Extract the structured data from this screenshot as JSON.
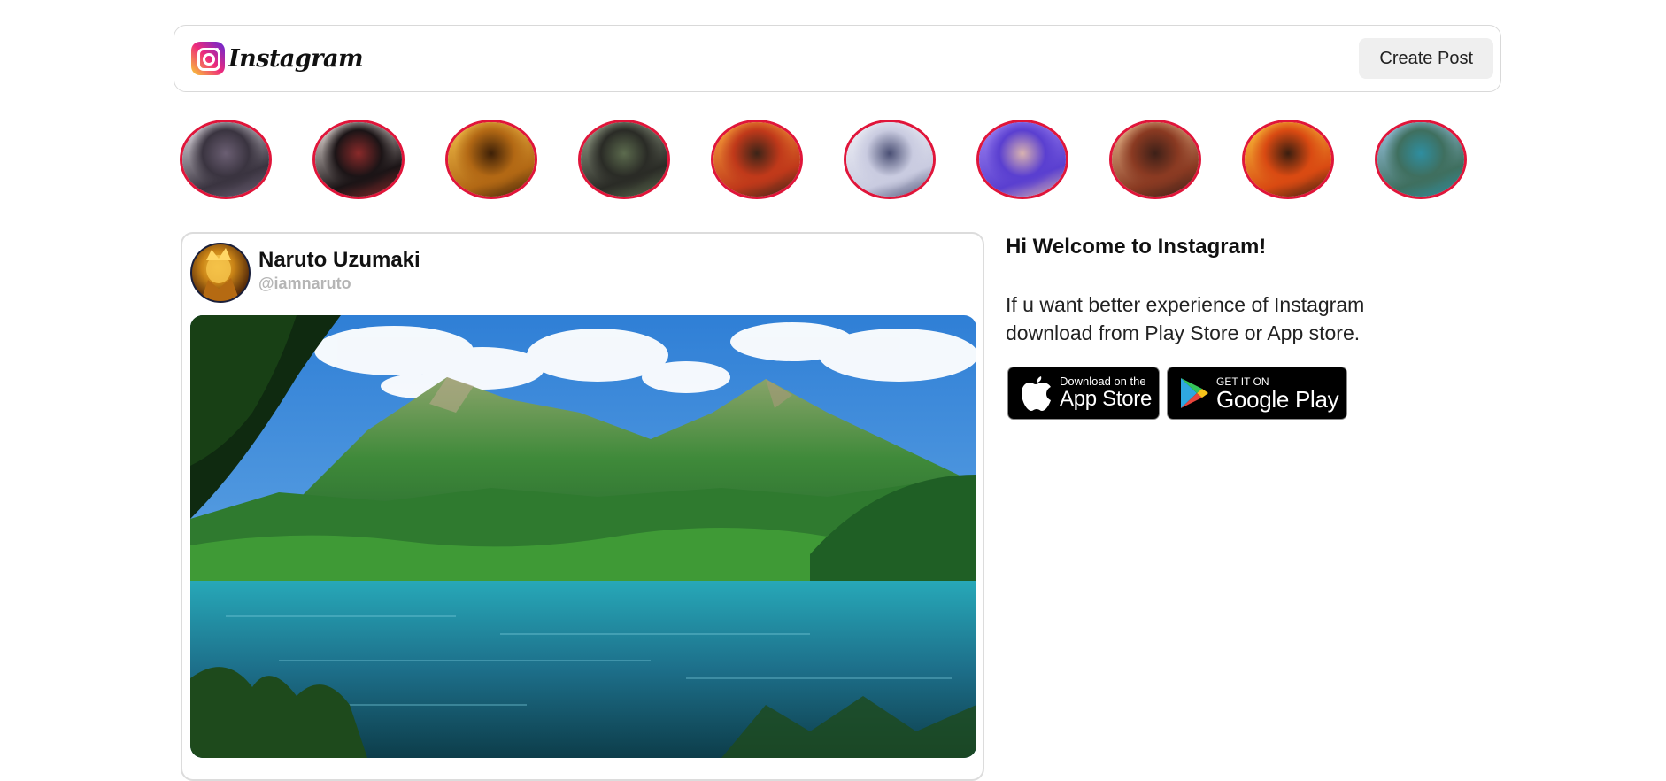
{
  "header": {
    "brand_name": "Instagram",
    "create_button_label": "Create Post"
  },
  "stories": [
    {
      "name": "story-sasuke",
      "colors": [
        "#e8e3ea",
        "#3a3440",
        "#6b5f73"
      ]
    },
    {
      "name": "story-itachi",
      "colors": [
        "#f2e9e4",
        "#1b1416",
        "#8a2a2a"
      ]
    },
    {
      "name": "story-naruto",
      "colors": [
        "#f3c04a",
        "#b26814",
        "#3d2007"
      ]
    },
    {
      "name": "story-man",
      "colors": [
        "#9aa58d",
        "#2a2b26",
        "#5c6b4e"
      ]
    },
    {
      "name": "story-pizza",
      "colors": [
        "#f9a33a",
        "#c0391a",
        "#3b2418"
      ]
    },
    {
      "name": "story-anime-girl",
      "colors": [
        "#eef0f6",
        "#c9cbe0",
        "#4a4f74"
      ]
    },
    {
      "name": "story-selfie",
      "colors": [
        "#9f86f2",
        "#5a3fd0",
        "#d9b3b0"
      ]
    },
    {
      "name": "story-art-girl",
      "colors": [
        "#e8b98c",
        "#8a3a22",
        "#3d2018"
      ]
    },
    {
      "name": "story-fireplace",
      "colors": [
        "#f9c23a",
        "#d94a12",
        "#3a1e10"
      ]
    },
    {
      "name": "story-lake",
      "colors": [
        "#9cc8e8",
        "#3f6f5f",
        "#2f8ea0"
      ]
    }
  ],
  "post": {
    "author_name": "Naruto Uzumaki",
    "author_handle": "@iamnaruto"
  },
  "sidebar": {
    "welcome": "Hi Welcome to Instagram!",
    "info": "If u want better experience of Instagram download from Play Store or App store.",
    "app_store": {
      "small": "Download on the",
      "big": "App Store"
    },
    "google_play": {
      "small": "GET IT ON",
      "big": "Google Play"
    }
  }
}
